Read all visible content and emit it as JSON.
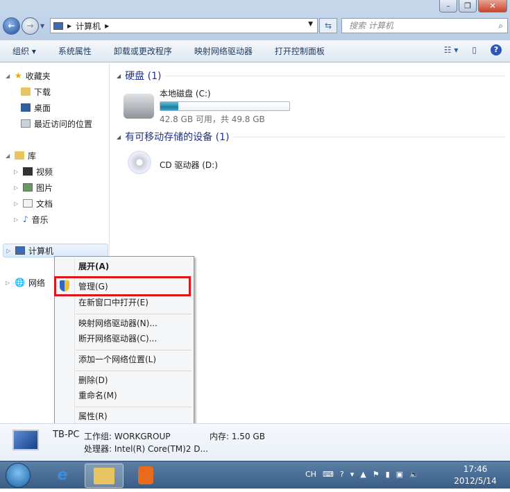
{
  "address": {
    "path": "计算机"
  },
  "search": {
    "placeholder": "搜索 计算机",
    "icon": "search-icon"
  },
  "toolbar": {
    "organize": "组织 ▾",
    "system_properties": "系统属性",
    "uninstall": "卸载或更改程序",
    "map_drive": "映射网络驱动器",
    "control_panel": "打开控制面板"
  },
  "sidebar": {
    "favorites": "收藏夹",
    "downloads": "下载",
    "desktop": "桌面",
    "recent": "最近访问的位置",
    "libraries": "库",
    "videos": "视频",
    "pictures": "图片",
    "documents": "文档",
    "music": "音乐",
    "computer": "计算机",
    "network": "网络"
  },
  "content": {
    "hdd_group": "硬盘 (1)",
    "c_drive": {
      "name": "本地磁盘 (C:)",
      "free": "42.8 GB 可用，共 49.8 GB",
      "used_fraction": 0.14
    },
    "removable_group": "有可移动存储的设备 (1)",
    "d_drive": {
      "name": "CD 驱动器 (D:)"
    }
  },
  "menu": {
    "expand": "展开(A)",
    "manage": "管理(G)",
    "open_new": "在新窗口中打开(E)",
    "map": "映射网络驱动器(N)...",
    "disconnect": "断开网络驱动器(C)...",
    "add_location": "添加一个网络位置(L)",
    "delete": "删除(D)",
    "rename": "重命名(M)",
    "properties": "属性(R)"
  },
  "details": {
    "name": "TB-PC",
    "workgroup": "工作组: WORKGROUP",
    "memory": "内存: 1.50 GB",
    "processor": "处理器: Intel(R) Core(TM)2 D..."
  },
  "taskbar": {
    "lang": "CH",
    "time": "17:46",
    "date": "2012/5/14"
  },
  "colors": {
    "highlight": "#e0141b",
    "group_header": "#1e3287",
    "bar_fill": "#1d7fa3"
  }
}
